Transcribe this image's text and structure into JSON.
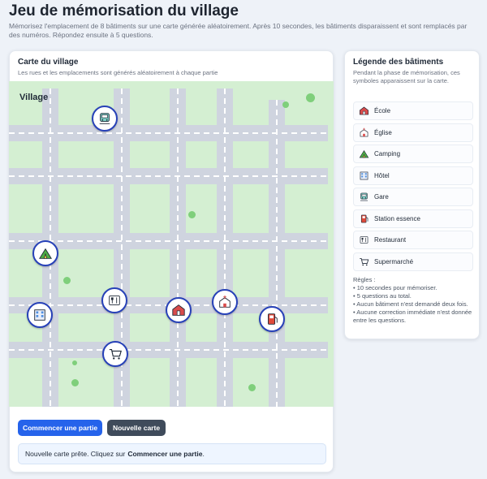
{
  "header": {
    "title": "Jeu de mémorisation du village",
    "subtitle": "Mémorisez l'emplacement de 8 bâtiments sur une carte générée aléatoirement. Après 10 secondes, les bâtiments disparaissent et sont remplacés par des numéros. Répondez ensuite à 5 questions."
  },
  "map_card": {
    "title": "Carte du village",
    "subtitle": "Les rues et les emplacements sont générés aléatoirement à chaque partie",
    "map_label": "Village",
    "markers": [
      {
        "icon": "train-station-icon",
        "building": "Gare"
      },
      {
        "icon": "camping-icon",
        "building": "Camping"
      },
      {
        "icon": "restaurant-icon",
        "building": "Restaurant"
      },
      {
        "icon": "school-icon",
        "building": "École"
      },
      {
        "icon": "church-icon",
        "building": "Église"
      },
      {
        "icon": "hotel-icon",
        "building": "Hôtel"
      },
      {
        "icon": "gas-station-icon",
        "building": "Station essence"
      },
      {
        "icon": "supermarket-icon",
        "building": "Supermarché"
      }
    ]
  },
  "buttons": {
    "start": "Commencer une partie",
    "new_map": "Nouvelle carte"
  },
  "status": {
    "text": "Nouvelle carte prête. Cliquez sur",
    "emphasis": "Commencer une partie",
    "suffix": "."
  },
  "legend": {
    "title": "Légende des bâtiments",
    "subtitle": "Pendant la phase de mémorisation, ces symboles apparaissent sur la carte.",
    "items": [
      {
        "label": "École",
        "icon": "school-icon"
      },
      {
        "label": "Église",
        "icon": "church-icon"
      },
      {
        "label": "Camping",
        "icon": "camping-icon"
      },
      {
        "label": "Hôtel",
        "icon": "hotel-icon"
      },
      {
        "label": "Gare",
        "icon": "train-station-icon"
      },
      {
        "label": "Station essence",
        "icon": "gas-station-icon"
      },
      {
        "label": "Restaurant",
        "icon": "restaurant-icon"
      },
      {
        "label": "Supermarché",
        "icon": "supermarket-icon"
      }
    ],
    "rules_title": "Règles :",
    "rules": [
      "• 10 secondes pour mémoriser.",
      "• 5 questions au total.",
      "• Aucun bâtiment n'est demandé deux fois.",
      "• Aucune correction immédiate n'est donnée entre les questions."
    ]
  },
  "colors": {
    "accent": "#2563eb",
    "secondary_button": "#3f4b5b",
    "map_grass": "#d4efd2",
    "road": "#cfd4df",
    "marker_border": "#2741b8"
  }
}
